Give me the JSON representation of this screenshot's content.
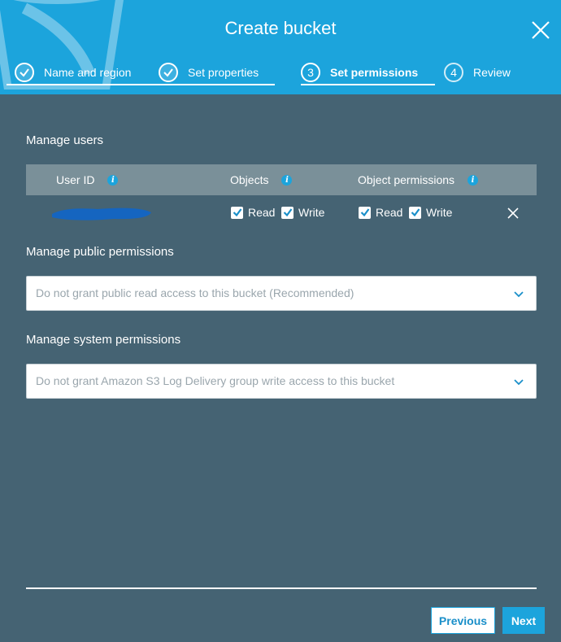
{
  "dialog": {
    "title": "Create bucket"
  },
  "steps": [
    {
      "number": "1",
      "label": "Name and region",
      "state": "done"
    },
    {
      "number": "2",
      "label": "Set properties",
      "state": "done"
    },
    {
      "number": "3",
      "label": "Set permissions",
      "state": "active"
    },
    {
      "number": "4",
      "label": "Review",
      "state": "pending"
    }
  ],
  "manage_users": {
    "title": "Manage users",
    "columns": {
      "user_id": "User ID",
      "objects": "Objects",
      "object_permissions": "Object permissions"
    },
    "row": {
      "objects_read": {
        "label": "Read",
        "checked": true
      },
      "objects_write": {
        "label": "Write",
        "checked": true
      },
      "perm_read": {
        "label": "Read",
        "checked": true
      },
      "perm_write": {
        "label": "Write",
        "checked": true
      }
    }
  },
  "public_permissions": {
    "title": "Manage public permissions",
    "selected": "Do not grant public read access to this bucket (Recommended)"
  },
  "system_permissions": {
    "title": "Manage system permissions",
    "selected": "Do not grant Amazon S3 Log Delivery group write access to this bucket"
  },
  "footer": {
    "previous_label": "Previous",
    "next_label": "Next"
  },
  "colors": {
    "header": "#1ca4dc",
    "body": "#456373",
    "table_header": "#7a9099",
    "accent": "#1ca4dc",
    "redaction": "#1565c0"
  },
  "icons": {
    "close": "close-icon",
    "check": "checkmark-icon",
    "info": "info-icon",
    "chevron": "chevron-down-icon"
  }
}
